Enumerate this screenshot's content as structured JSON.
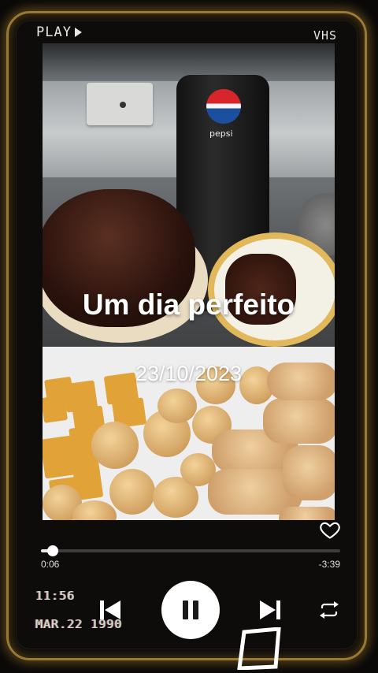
{
  "vhs": {
    "play_label": "PLAY",
    "tag": "VHS"
  },
  "video": {
    "title": "Um dia perfeito",
    "date": "23/10/2023"
  },
  "photo": {
    "brand_text": "pepsi"
  },
  "player": {
    "elapsed": "0:06",
    "remaining": "-3:39",
    "progress_fraction": 0.04
  },
  "stamp": {
    "time": "11:56",
    "date": "MAR.22 1990"
  },
  "icons": [
    "heart-icon",
    "previous-icon",
    "pause-icon",
    "next-icon",
    "repeat-icon",
    "play-icon"
  ],
  "colors": {
    "frame": "#9a7a33",
    "background": "#0a0908",
    "text": "#ffffff"
  }
}
